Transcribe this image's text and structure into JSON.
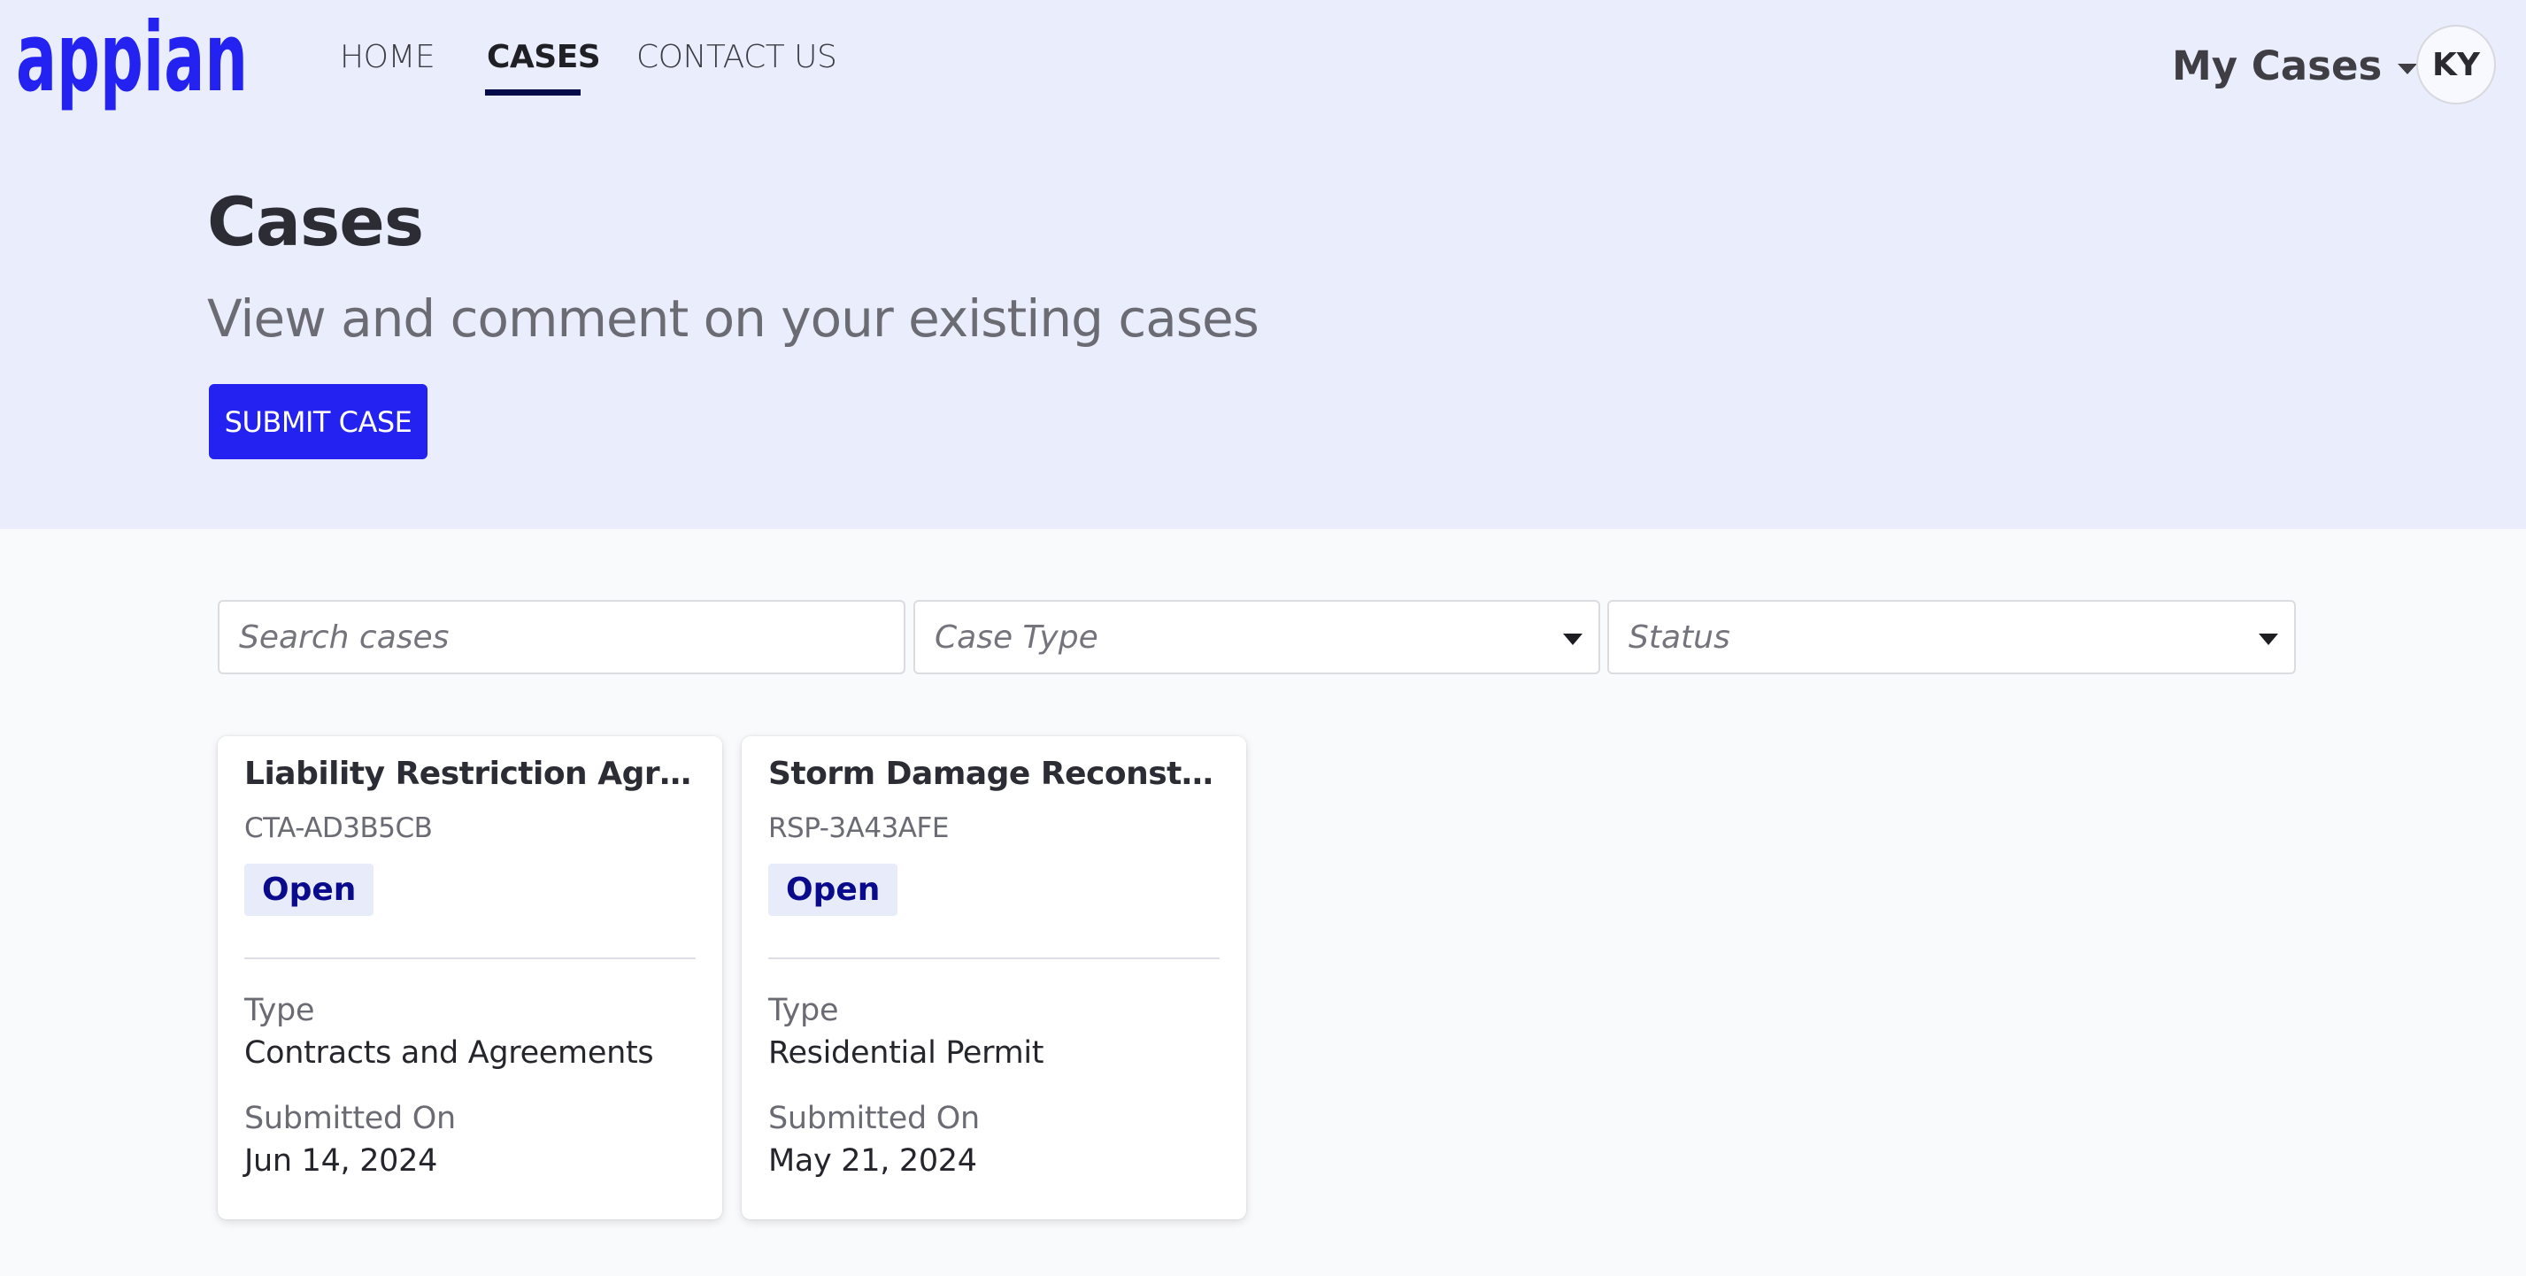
{
  "brand": {
    "logo_text": "appian",
    "accent_color": "#2422F0"
  },
  "nav": {
    "items": [
      {
        "label": "HOME",
        "active": false
      },
      {
        "label": "CASES",
        "active": true
      },
      {
        "label": "CONTACT US",
        "active": false
      }
    ]
  },
  "user_menu": {
    "label": "My Cases",
    "icon": "caret-down-icon",
    "avatar_initials": "KY"
  },
  "hero": {
    "title": "Cases",
    "subtitle": "View and comment on your existing cases",
    "submit_button": "SUBMIT CASE"
  },
  "filters": {
    "search": {
      "placeholder": "Search cases",
      "value": ""
    },
    "case_type": {
      "placeholder": "Case Type",
      "value": ""
    },
    "status": {
      "placeholder": "Status",
      "value": ""
    }
  },
  "cases": [
    {
      "title": "Liability Restriction Agreement",
      "title_display": "Liability Restriction Agree...",
      "id": "CTA-AD3B5CB",
      "status": "Open",
      "type_label": "Type",
      "type": "Contracts and Agreements",
      "submitted_label": "Submitted On",
      "submitted_on": "Jun 14, 2024"
    },
    {
      "title": "Storm Damage Reconstruction",
      "title_display": "Storm Damage Reconstruct...",
      "id": "RSP-3A43AFE",
      "status": "Open",
      "type_label": "Type",
      "type": "Residential Permit",
      "submitted_label": "Submitted On",
      "submitted_on": "May 21, 2024"
    }
  ],
  "colors": {
    "hero_bg": "#EAEDFC",
    "page_bg": "#F9FAFC",
    "badge_bg": "#E8EBFA",
    "badge_text": "#0A0A8C",
    "nav_underline": "#050A4A"
  }
}
